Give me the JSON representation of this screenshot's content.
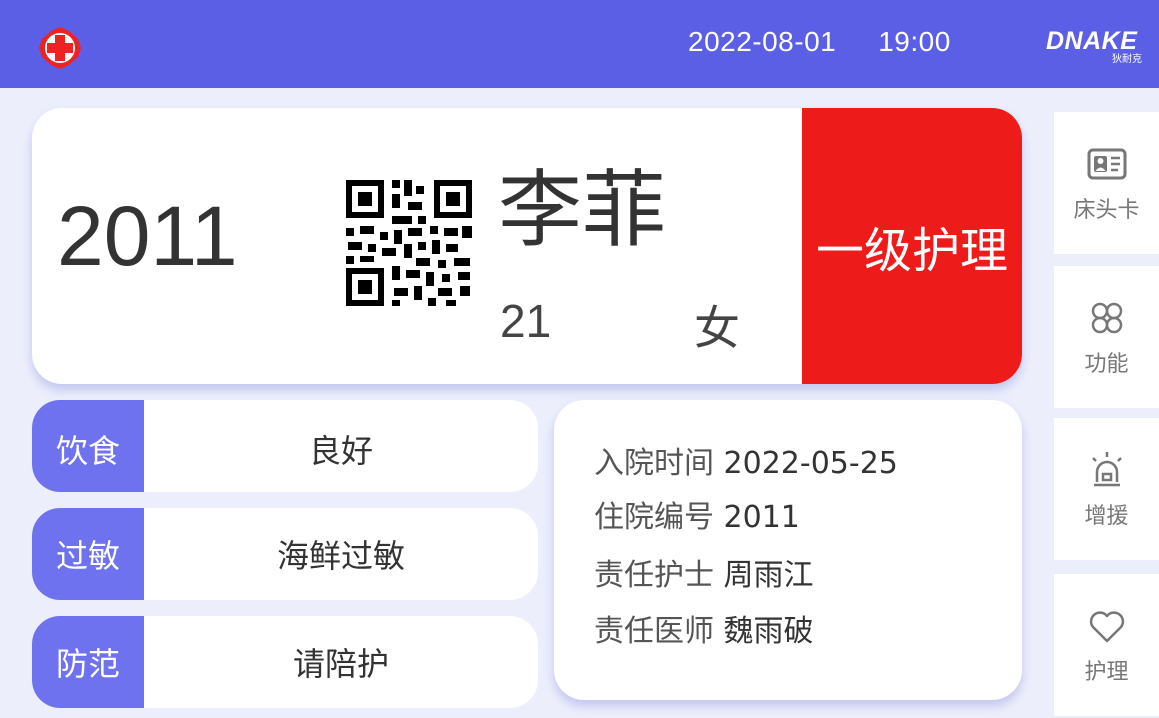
{
  "header": {
    "date": "2022-08-01",
    "time": "19:00",
    "brand_name": "DNAKE",
    "brand_sub": "狄耐克",
    "logo_icon": "red-cross-hospital-icon",
    "bar_color": "#5b5fe5"
  },
  "patient": {
    "bed_number": "2011",
    "name": "李菲",
    "age": "21",
    "gender": "女",
    "care_level": "一级护理",
    "care_level_color": "#ee1b1b"
  },
  "info_rows": [
    {
      "label": "饮食",
      "value": "良好"
    },
    {
      "label": "过敏",
      "value": "海鲜过敏"
    },
    {
      "label": "防范",
      "value": "请陪护"
    }
  ],
  "details": {
    "admission_label": "入院时间",
    "admission_value": "2022-05-25",
    "record_label": "住院编号",
    "record_value": "2011",
    "nurse_label": "责任护士",
    "nurse_value": "周雨江",
    "doctor_label": "责任医师",
    "doctor_value": "魏雨破"
  },
  "side_nav": [
    {
      "label": "床头卡",
      "icon": "id-card-icon"
    },
    {
      "label": "功能",
      "icon": "function-grid-icon"
    },
    {
      "label": "增援",
      "icon": "alarm-light-icon"
    },
    {
      "label": "护理",
      "icon": "heart-icon"
    }
  ]
}
